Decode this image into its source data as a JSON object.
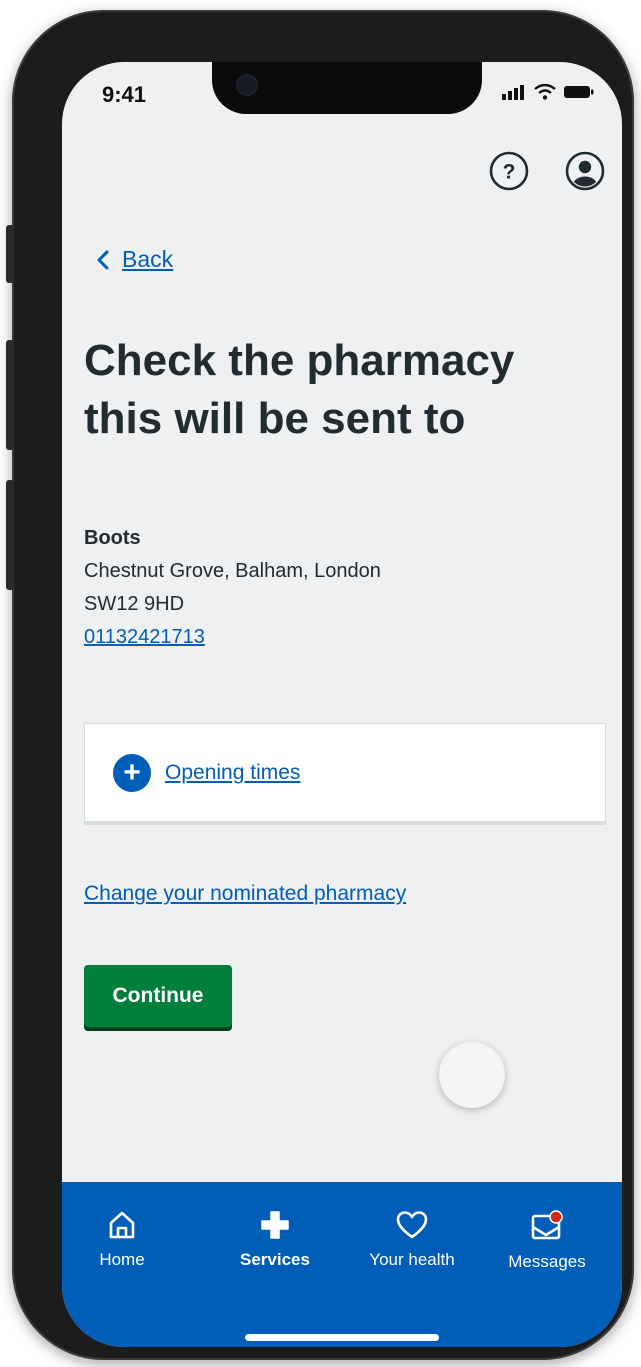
{
  "status_bar": {
    "time": "9:41"
  },
  "header": {
    "help_icon": "help-question-icon",
    "profile_icon": "profile-icon"
  },
  "back": {
    "label": "Back"
  },
  "page": {
    "title": "Check the pharmacy this will be sent to"
  },
  "pharmacy": {
    "name": "Boots",
    "address_line": "Chestnut Grove, Balham, London",
    "postcode": "SW12 9HD",
    "phone": "01132421713"
  },
  "opening_times": {
    "label": "Opening times"
  },
  "change_link": {
    "label": "Change your nominated pharmacy"
  },
  "continue_button": {
    "label": "Continue"
  },
  "tab_bar": {
    "tabs": [
      {
        "label": "Home",
        "icon": "home-icon",
        "active": false
      },
      {
        "label": "Services",
        "icon": "plus-icon",
        "active": true
      },
      {
        "label": "Your health",
        "icon": "heart-icon",
        "active": false
      },
      {
        "label": "Messages",
        "icon": "messages-icon",
        "active": false
      }
    ]
  },
  "colors": {
    "nhs_blue": "#005eb8",
    "continue_green": "#007f3b",
    "background": "#eef0f2",
    "text": "#212b32",
    "notification_dot": "#d5281b"
  }
}
